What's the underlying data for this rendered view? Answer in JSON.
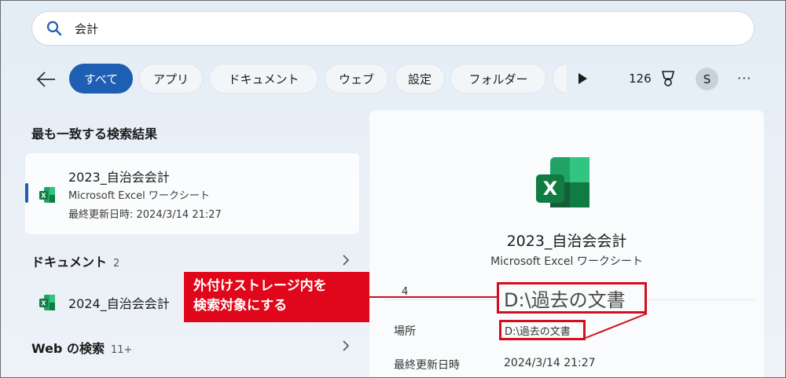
{
  "search": {
    "value": "会計"
  },
  "filters": {
    "all": "すべて",
    "apps": "アプリ",
    "documents": "ドキュメント",
    "web": "ウェブ",
    "settings": "設定",
    "folders": "フォルダー"
  },
  "toolbar": {
    "count": "126",
    "avatar": "S",
    "more": "···"
  },
  "best_match": {
    "section": "最も一致する検索結果",
    "title": "2023_自治会会計",
    "type": "Microsoft Excel ワークシート",
    "modified": "最終更新日時: 2024/3/14 21:27"
  },
  "documents": {
    "section": "ドキュメント",
    "count": "2",
    "items": [
      {
        "title": "2024_自治会会計"
      }
    ]
  },
  "web": {
    "section": "Web の検索",
    "count": "11+"
  },
  "detail": {
    "title": "2023_自治会会計",
    "type": "Microsoft Excel ワークシート",
    "number": "4",
    "location_label": "場所",
    "location_value": "D:\\過去の文書",
    "modified_label": "最終更新日時",
    "modified_value": "2024/3/14 21:27"
  },
  "callout": {
    "line1": "外付けストレージ内を",
    "line2": "検索対象にする",
    "zoom_text": "D:\\過去の文書"
  },
  "colors": {
    "accent": "#1e5fb3",
    "callout": "#e1071a",
    "excel_green": "#107c41"
  }
}
